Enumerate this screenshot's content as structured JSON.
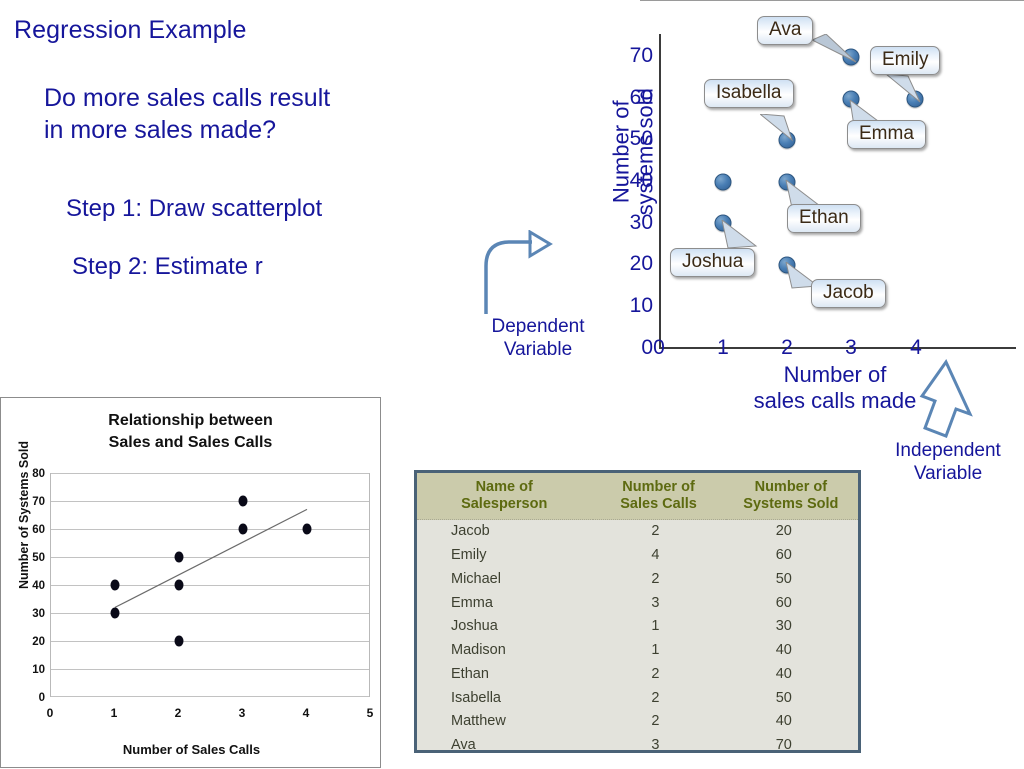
{
  "slide": {
    "title": "Regression Example",
    "question_line1": "Do more sales calls result",
    "question_line2": "in more sales made?",
    "step1": "Step 1: Draw scatterplot",
    "step2": "Step 2: Estimate r"
  },
  "scatter": {
    "y_axis_label_line1": "Number of",
    "y_axis_label_line2": "systems sold",
    "x_axis_label_line1": "Number of",
    "x_axis_label_line2": "sales calls made",
    "dependent_note_line1": "Dependent",
    "dependent_note_line2": "Variable",
    "independent_note_line1": "Independent",
    "independent_note_line2": "Variable",
    "y_ticks": [
      "70",
      "60",
      "50",
      "40",
      "30",
      "20",
      "10",
      "0"
    ],
    "x_ticks": [
      "0",
      "1",
      "2",
      "3",
      "4"
    ],
    "callouts": [
      {
        "name": "Ava"
      },
      {
        "name": "Emily"
      },
      {
        "name": "Isabella"
      },
      {
        "name": "Emma"
      },
      {
        "name": "Ethan"
      },
      {
        "name": "Joshua"
      },
      {
        "name": "Jacob"
      }
    ]
  },
  "excel_chart": {
    "title_line1": "Relationship between",
    "title_line2": "Sales and Sales Calls",
    "y_ticks": [
      "80",
      "70",
      "60",
      "50",
      "40",
      "30",
      "20",
      "10",
      "0"
    ],
    "x_ticks": [
      "0",
      "1",
      "2",
      "3",
      "4",
      "5"
    ]
  },
  "table": {
    "headers": {
      "name_line1": "Name of",
      "name_line2": "Salesperson",
      "calls_line1": "Number of",
      "calls_line2": "Sales Calls",
      "sold_line1": "Number of",
      "sold_line2": "Systems Sold"
    },
    "rows": [
      {
        "name": "Jacob",
        "calls": "2",
        "sold": "20"
      },
      {
        "name": "Emily",
        "calls": "4",
        "sold": "60"
      },
      {
        "name": "Michael",
        "calls": "2",
        "sold": "50"
      },
      {
        "name": "Emma",
        "calls": "3",
        "sold": "60"
      },
      {
        "name": "Joshua",
        "calls": "1",
        "sold": "30"
      },
      {
        "name": "Madison",
        "calls": "1",
        "sold": "40"
      },
      {
        "name": "Ethan",
        "calls": "2",
        "sold": "40"
      },
      {
        "name": "Isabella",
        "calls": "2",
        "sold": "50"
      },
      {
        "name": "Matthew",
        "calls": "2",
        "sold": "40"
      },
      {
        "name": "Ava",
        "calls": "3",
        "sold": "70"
      }
    ]
  },
  "colors": {
    "text_blue": "#16169b",
    "point_blue": "#4a7fb5",
    "callout_text": "#3b2a16",
    "table_header_bg": "#cbcbab",
    "table_header_text": "#5d6a10",
    "table_body_bg": "#e3e3dc",
    "table_border": "#4a6277",
    "arrow_blue": "#5b86b5"
  },
  "chart_data": [
    {
      "type": "scatter",
      "id": "labeled-scatterplot",
      "title": "",
      "xlabel": "Number of sales calls made",
      "ylabel": "Number of systems sold",
      "xlim": [
        0,
        4.6
      ],
      "ylim": [
        0,
        75
      ],
      "xticks": [
        0,
        1,
        2,
        3,
        4
      ],
      "yticks": [
        0,
        10,
        20,
        30,
        40,
        50,
        60,
        70
      ],
      "grid": false,
      "points": [
        {
          "label": "Jacob",
          "x": 2,
          "y": 20
        },
        {
          "label": "Emily",
          "x": 4,
          "y": 60
        },
        {
          "label": "Michael",
          "x": 2,
          "y": 50
        },
        {
          "label": "Emma",
          "x": 3,
          "y": 60
        },
        {
          "label": "Joshua",
          "x": 1,
          "y": 30
        },
        {
          "label": "Madison",
          "x": 1,
          "y": 40
        },
        {
          "label": "Ethan",
          "x": 2,
          "y": 40
        },
        {
          "label": "Isabella",
          "x": 2,
          "y": 50
        },
        {
          "label": "Ava",
          "x": 3,
          "y": 70
        }
      ],
      "annotations": [
        "Ava",
        "Emily",
        "Isabella",
        "Emma",
        "Ethan",
        "Joshua",
        "Jacob",
        "Dependent Variable",
        "Independent Variable"
      ]
    },
    {
      "type": "scatter",
      "id": "excel-scatterplot",
      "title": "Relationship between Sales and Sales Calls",
      "xlabel": "Number of Sales Calls",
      "ylabel": "Number of Systems Sold",
      "xlim": [
        0,
        5
      ],
      "ylim": [
        0,
        80
      ],
      "xticks": [
        0,
        1,
        2,
        3,
        4,
        5
      ],
      "yticks": [
        0,
        10,
        20,
        30,
        40,
        50,
        60,
        70,
        80
      ],
      "grid": true,
      "x": [
        1,
        1,
        2,
        2,
        2,
        2,
        3,
        3,
        4
      ],
      "y": [
        30,
        40,
        20,
        40,
        50,
        50,
        60,
        70,
        60
      ],
      "trendline": {
        "x": [
          1,
          4
        ],
        "y": [
          32,
          67
        ]
      }
    }
  ]
}
